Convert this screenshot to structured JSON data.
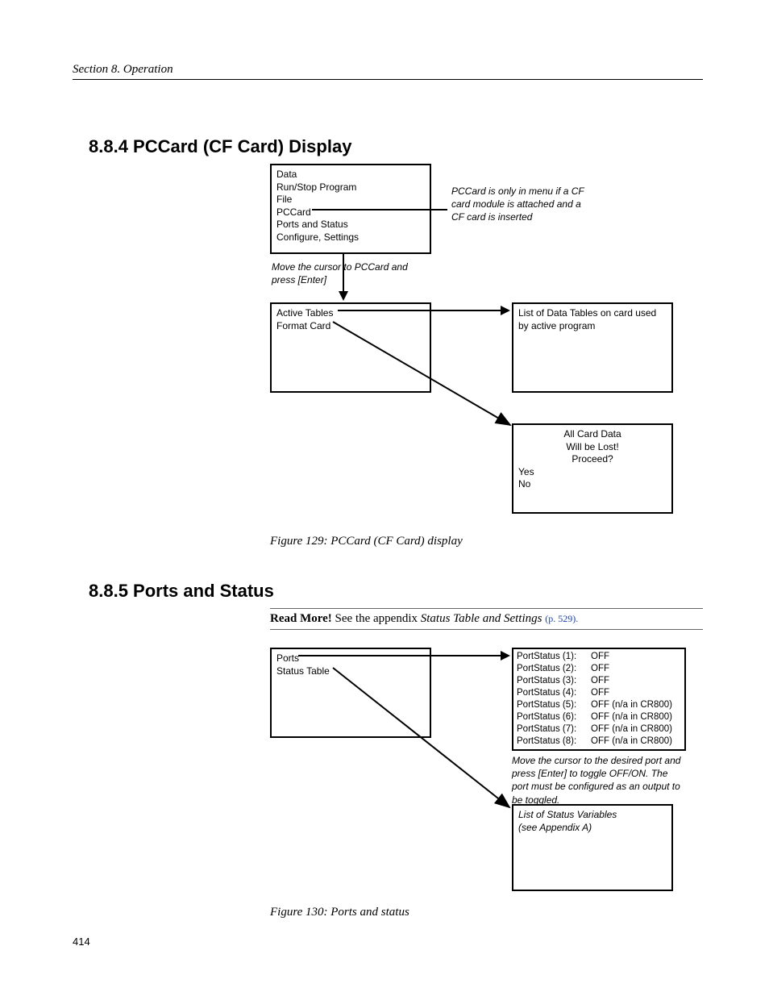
{
  "header": {
    "running_title": "Section 8.  Operation"
  },
  "section1": {
    "heading": "8.8.4 PCCard (CF Card) Display",
    "figure_caption": "Figure 129: PCCard (CF Card) display",
    "menu_box": {
      "items": [
        "Data",
        "Run/Stop Program",
        "File",
        "PCCard",
        "Ports and Status",
        "Configure, Settings"
      ]
    },
    "side_note": "PCCard is only in menu if a CF card module is attached and a CF card is inserted",
    "instruction": "Move the cursor to PCCard and press [Enter]",
    "submenu_box": {
      "items": [
        "Active Tables",
        "Format Card"
      ]
    },
    "right_box1": "List of Data Tables on card used by active program",
    "warning_box": {
      "centered": [
        "All Card Data",
        "Will be Lost!",
        "Proceed?"
      ],
      "left": [
        "Yes",
        "No"
      ]
    }
  },
  "section2": {
    "heading": "8.8.5 Ports and Status",
    "readmore_bold": "Read More!",
    "readmore_plain": " See the appendix ",
    "readmore_italic": "Status Table and Settings ",
    "readmore_link": "(p. 529).",
    "figure_caption": "Figure 130: Ports and status",
    "menu_box": {
      "items": [
        "Ports",
        "Status Table"
      ]
    },
    "port_status_rows": [
      {
        "label": "PortStatus (1):",
        "value": "OFF"
      },
      {
        "label": "PortStatus (2):",
        "value": "OFF"
      },
      {
        "label": "PortStatus (3):",
        "value": "OFF"
      },
      {
        "label": "PortStatus (4):",
        "value": "OFF"
      },
      {
        "label": "PortStatus (5):",
        "value": "OFF (n/a in CR800)"
      },
      {
        "label": "PortStatus (6):",
        "value": "OFF (n/a in CR800)"
      },
      {
        "label": "PortStatus (7):",
        "value": "OFF (n/a in CR800)"
      },
      {
        "label": "PortStatus (8):",
        "value": "OFF (n/a in CR800)"
      }
    ],
    "port_note": "Move the cursor to the desired port and press [Enter] to toggle OFF/ON. The port must be configured as an output to be toggled.",
    "status_list_box": "List of Status Variables\n(see Appendix A)"
  },
  "page_number": "414"
}
